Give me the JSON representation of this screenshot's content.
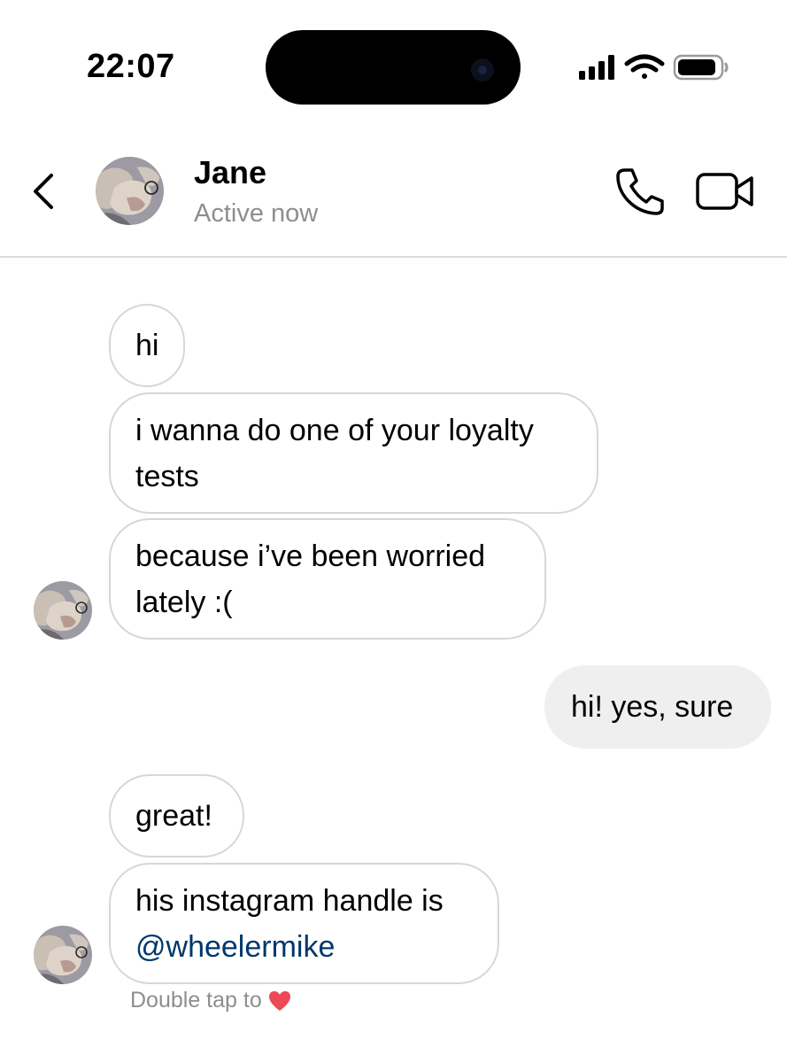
{
  "status_bar": {
    "time": "22:07",
    "icons": [
      "signal-icon",
      "wifi-icon",
      "battery-icon"
    ]
  },
  "header": {
    "contact_name": "Jane",
    "activity_status": "Active now",
    "icons": [
      "back-icon",
      "phone-icon",
      "video-camera-icon"
    ]
  },
  "messages": [
    {
      "sender": "Jane",
      "direction": "incoming",
      "lines": [
        "hi"
      ]
    },
    {
      "sender": "Jane",
      "direction": "incoming",
      "lines": [
        "i wanna do one of your loyalty",
        "tests"
      ]
    },
    {
      "sender": "Jane",
      "direction": "incoming",
      "lines": [
        "because i’ve been worried",
        "lately :("
      ]
    },
    {
      "sender": "me",
      "direction": "outgoing",
      "lines": [
        "hi! yes, sure"
      ]
    },
    {
      "sender": "Jane",
      "direction": "incoming",
      "lines": [
        "great!"
      ]
    },
    {
      "sender": "Jane",
      "direction": "incoming",
      "lines": [
        "his instagram handle is",
        "@wheelermike"
      ]
    }
  ],
  "reaction_hint": {
    "text": "Double tap to",
    "icon": "red-heart-icon"
  },
  "colors": {
    "background": "#ffffff",
    "secondary_text": "#8e8e8e",
    "incoming_bubble_border": "#d7d7d7",
    "outgoing_bubble_bg": "#efefef",
    "mention_link": "#00376b",
    "heart": "#ed4956"
  }
}
